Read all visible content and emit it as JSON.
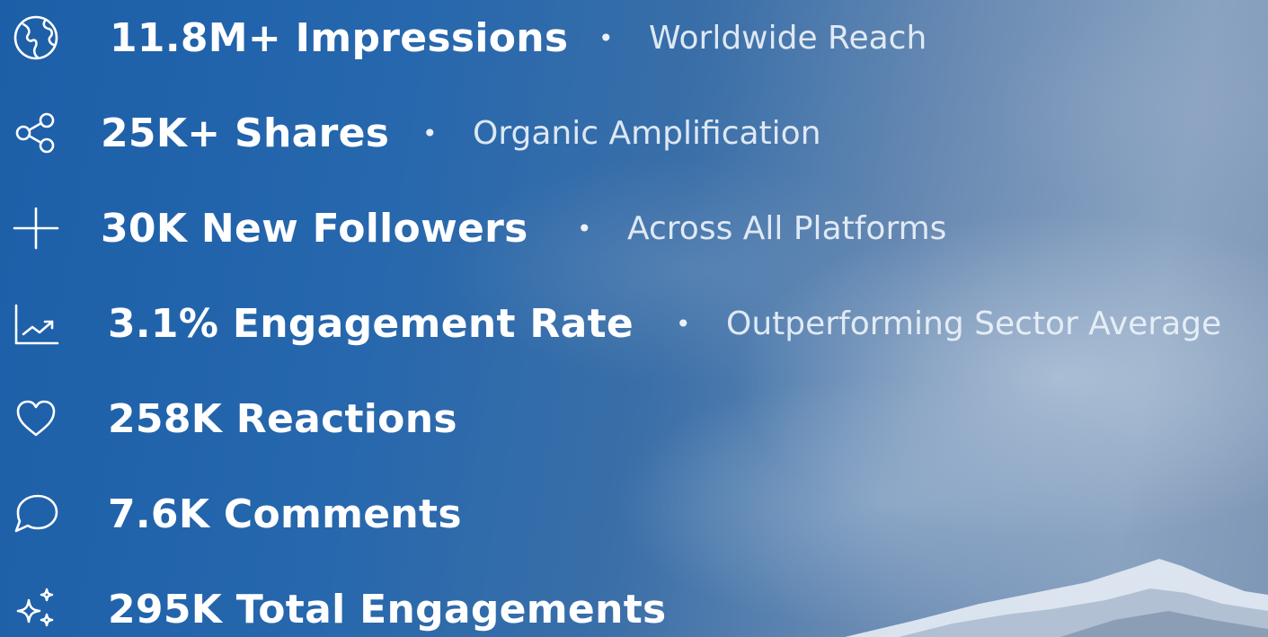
{
  "separator": "•",
  "stats": [
    {
      "icon": "globe-icon",
      "metric": "11.8M+ Impressions",
      "description": "Worldwide Reach"
    },
    {
      "icon": "share-icon",
      "metric": "25K+ Shares",
      "description": "Organic Amplification"
    },
    {
      "icon": "plus-icon",
      "metric": "30K New Followers",
      "description": "Across All Platforms"
    },
    {
      "icon": "trending-chart-icon",
      "metric": "3.1% Engagement Rate",
      "description": "Outperforming Sector Average"
    },
    {
      "icon": "heart-icon",
      "metric": "258K Reactions",
      "description": ""
    },
    {
      "icon": "comment-icon",
      "metric": "7.6K Comments",
      "description": ""
    },
    {
      "icon": "sparkles-icon",
      "metric": "295K Total Engagements",
      "description": ""
    }
  ]
}
